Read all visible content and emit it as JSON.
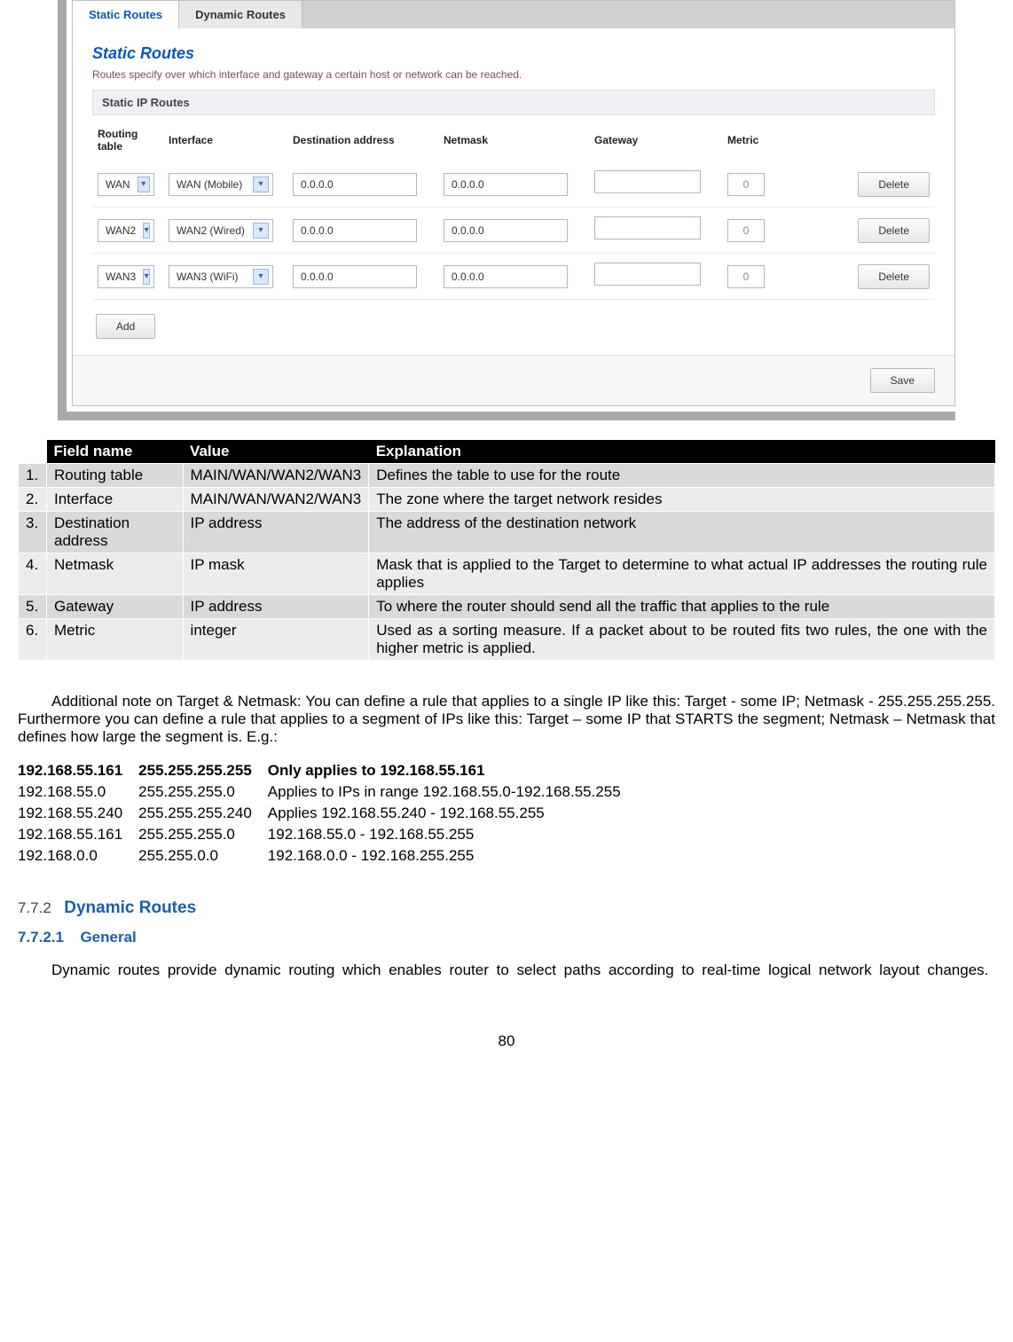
{
  "screenshot": {
    "tabs": [
      {
        "label": "Static Routes",
        "active": true
      },
      {
        "label": "Dynamic Routes",
        "active": false
      }
    ],
    "panel_title": "Static Routes",
    "panel_desc": "Routes specify over which interface and gateway a certain host or network can be reached.",
    "section_title": "Static IP Routes",
    "columns": {
      "routing_table": "Routing table",
      "interface": "Interface",
      "dest": "Destination address",
      "netmask": "Netmask",
      "gateway": "Gateway",
      "metric": "Metric"
    },
    "rows": [
      {
        "rt": "WAN",
        "if": "WAN (Mobile)",
        "dest": "0.0.0.0",
        "mask": "0.0.0.0",
        "gw": "",
        "metric": "0",
        "del": "Delete"
      },
      {
        "rt": "WAN2",
        "if": "WAN2 (Wired)",
        "dest": "0.0.0.0",
        "mask": "0.0.0.0",
        "gw": "",
        "metric": "0",
        "del": "Delete"
      },
      {
        "rt": "WAN3",
        "if": "WAN3 (WiFi)",
        "dest": "0.0.0.0",
        "mask": "0.0.0.0",
        "gw": "",
        "metric": "0",
        "del": "Delete"
      }
    ],
    "add_btn": "Add",
    "save_btn": "Save"
  },
  "field_table": {
    "head": {
      "name": "Field name",
      "value": "Value",
      "expl": "Explanation"
    },
    "rows": [
      {
        "n": "1.",
        "name": "Routing table",
        "value": "MAIN/WAN/WAN2/WAN3",
        "expl": "Defines the table to use for the route"
      },
      {
        "n": "2.",
        "name": "Interface",
        "value": "MAIN/WAN/WAN2/WAN3",
        "expl": "The zone where the target network resides"
      },
      {
        "n": "3.",
        "name": "Destination address",
        "value": "IP address",
        "expl": "The address of the destination network"
      },
      {
        "n": "4.",
        "name": "Netmask",
        "value": "IP mask",
        "expl": "Mask that is applied to the Target to determine to what actual IP addresses the routing rule applies"
      },
      {
        "n": "5.",
        "name": "Gateway",
        "value": "IP address",
        "expl": "To where the router should send all the traffic that applies to the rule"
      },
      {
        "n": "6.",
        "name": "Metric",
        "value": "integer",
        "expl": "Used as a sorting measure. If a packet about to be routed fits two rules, the one with the higher metric is applied."
      }
    ]
  },
  "note": "Additional note on Target & Netmask: You can define a rule that applies to a single IP like this: Target - some IP; Netmask - 255.255.255.255. Furthermore you can define a rule that applies to a segment of IPs like this: Target – some IP that STARTS the segment; Netmask – Netmask that defines how large the segment is. E.g.:",
  "examples": [
    {
      "ip": "192.168.55.161",
      "mask": "255.255.255.255",
      "desc": "Only applies to 192.168.55.161",
      "bold": true
    },
    {
      "ip": "192.168.55.0",
      "mask": "255.255.255.0",
      "desc": "Applies to IPs in range 192.168.55.0-192.168.55.255",
      "bold": false
    },
    {
      "ip": "192.168.55.240",
      "mask": "255.255.255.240",
      "desc": "Applies 192.168.55.240 -  192.168.55.255",
      "bold": false
    },
    {
      "ip": "192.168.55.161",
      "mask": "255.255.255.0",
      "desc": "192.168.55.0 - 192.168.55.255",
      "bold": false
    },
    {
      "ip": "192.168.0.0",
      "mask": "255.255.0.0",
      "desc": "192.168.0.0 - 192.168.255.255",
      "bold": false
    }
  ],
  "h1": {
    "num": "7.7.2",
    "title": "Dynamic Routes"
  },
  "h2": {
    "num": "7.7.2.1",
    "title": "General"
  },
  "para": "Dynamic routes provide dynamic routing which enables router to select paths according to real-time logical network layout changes.",
  "page_number": "80"
}
